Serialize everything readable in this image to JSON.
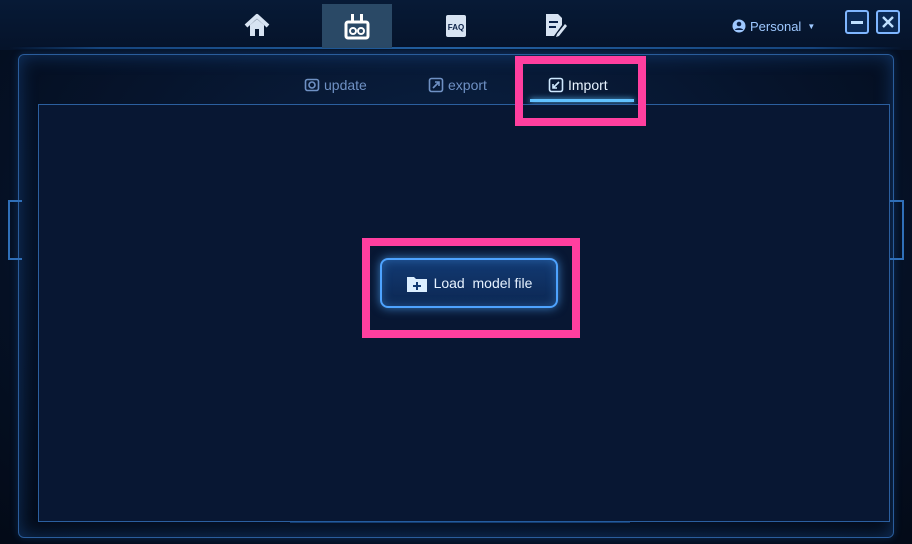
{
  "nav": [
    {
      "name": "home-icon"
    },
    {
      "name": "remote-controller-icon",
      "active": true
    },
    {
      "name": "faq-icon",
      "label": "FAQ"
    },
    {
      "name": "notes-edit-icon"
    }
  ],
  "account": {
    "label": "Personal"
  },
  "window_controls": {
    "minimize": "minimize",
    "close": "close"
  },
  "tabs": [
    {
      "label": "update"
    },
    {
      "label": "export"
    },
    {
      "label": "Import",
      "active": true
    }
  ],
  "main": {
    "load_button_label": "Load  model file"
  },
  "colors": {
    "highlight": "#ff3f9f",
    "accent": "#62c3ff",
    "active_nav_bg": "#2a4966"
  }
}
